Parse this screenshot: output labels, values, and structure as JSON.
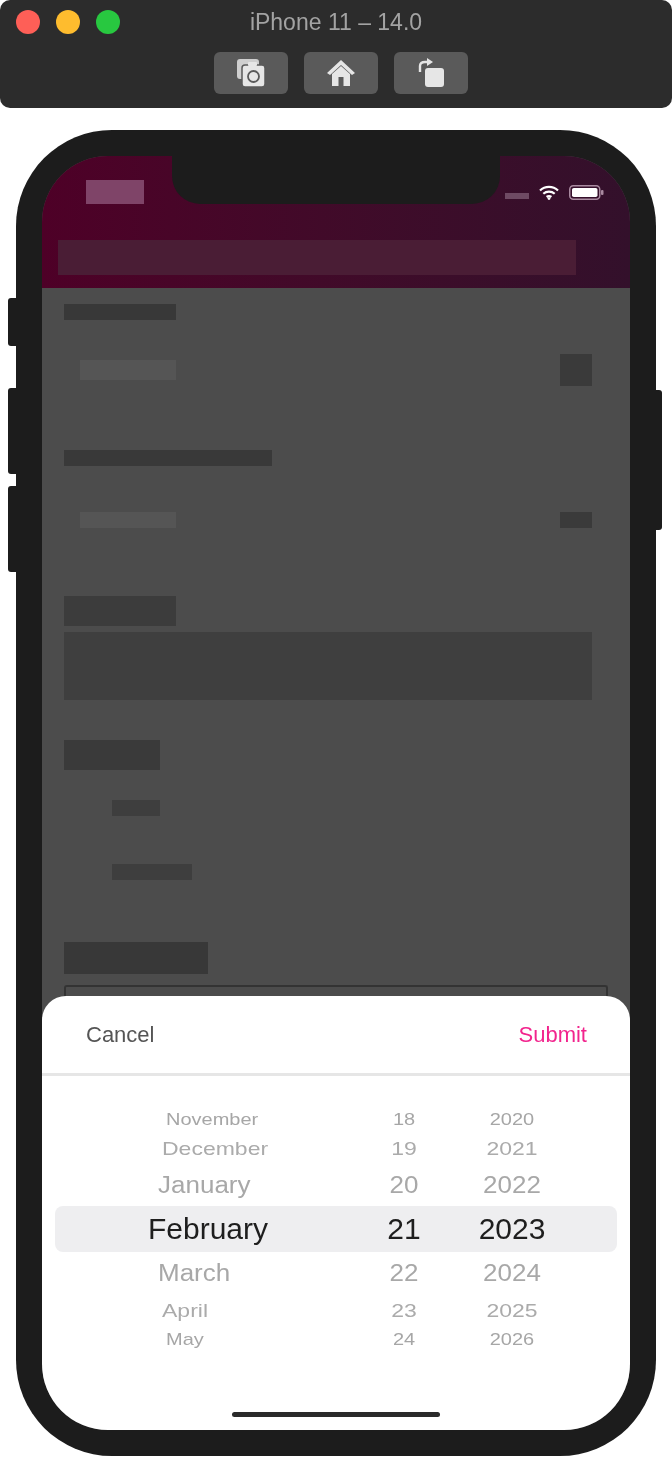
{
  "window": {
    "title": "iPhone 11 – 14.0"
  },
  "picker": {
    "cancel": "Cancel",
    "submit": "Submit",
    "columns": [
      {
        "kind": "month",
        "items": [
          {
            "label": "November",
            "selected": false
          },
          {
            "label": "December",
            "selected": false
          },
          {
            "label": "January",
            "selected": false
          },
          {
            "label": "February",
            "selected": true
          },
          {
            "label": "March",
            "selected": false
          },
          {
            "label": "April",
            "selected": false
          },
          {
            "label": "May",
            "selected": false
          }
        ]
      },
      {
        "kind": "day",
        "items": [
          {
            "label": "18",
            "selected": false
          },
          {
            "label": "19",
            "selected": false
          },
          {
            "label": "20",
            "selected": false
          },
          {
            "label": "21",
            "selected": true
          },
          {
            "label": "22",
            "selected": false
          },
          {
            "label": "23",
            "selected": false
          },
          {
            "label": "24",
            "selected": false
          }
        ]
      },
      {
        "kind": "year",
        "items": [
          {
            "label": "2020",
            "selected": false
          },
          {
            "label": "2021",
            "selected": false
          },
          {
            "label": "2022",
            "selected": false
          },
          {
            "label": "2023",
            "selected": true
          },
          {
            "label": "2024",
            "selected": false
          },
          {
            "label": "2025",
            "selected": false
          },
          {
            "label": "2026",
            "selected": false
          }
        ]
      }
    ]
  }
}
